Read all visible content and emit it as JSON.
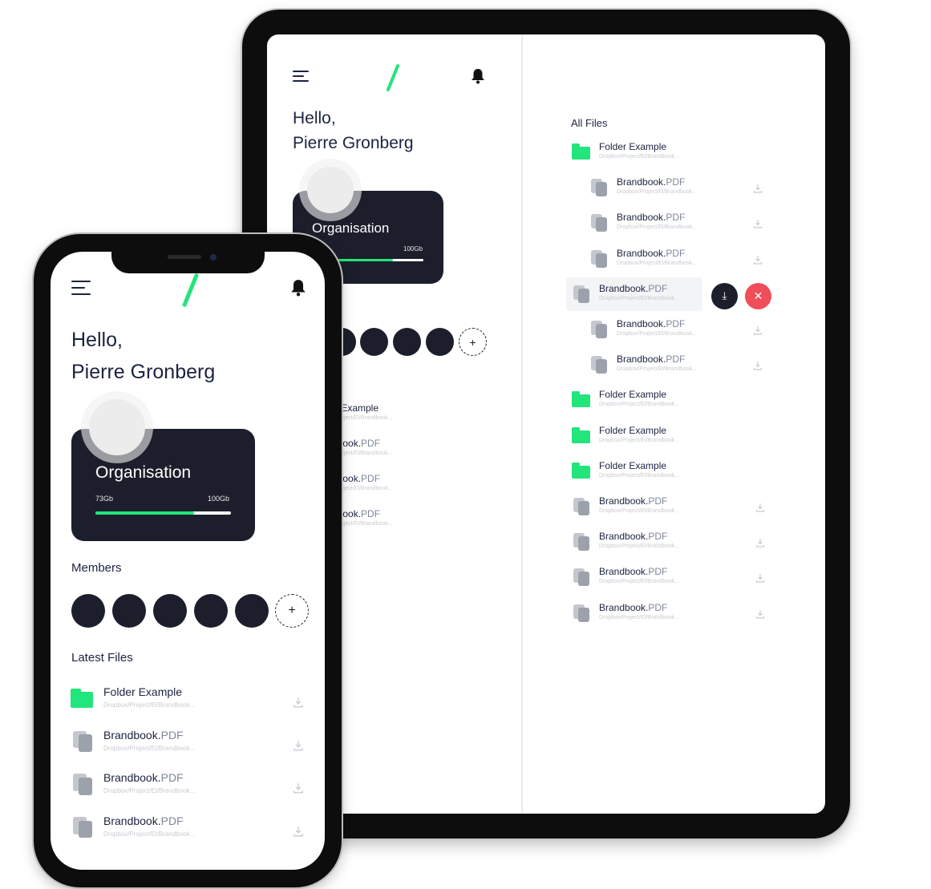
{
  "app": {
    "accent_color": "#22e57c",
    "dark_color": "#1c1f2b",
    "danger_color": "#f04e5a"
  },
  "header": {
    "menu_icon": "hamburger-menu-icon",
    "logo_icon": "green-slash-logo",
    "bell_icon": "bell-icon",
    "bell_glyph": "🔔"
  },
  "greeting": {
    "hello": "Hello,",
    "name": "Pierre Gronberg"
  },
  "organisation": {
    "title": "Organisation",
    "used": "73Gb",
    "total": "100Gb",
    "used_fraction": 0.73
  },
  "members": {
    "title": "Members",
    "count": 5,
    "add_glyph": "+"
  },
  "latest_files": {
    "title": "Latest Files",
    "items": [
      {
        "type": "folder",
        "name": "Folder Example",
        "ext": "",
        "path": "Dropbox/Project/El/Brandbook..."
      },
      {
        "type": "file",
        "name": "Brandbook.",
        "ext": "PDF",
        "path": "Dropbox/Project/El/Brandbook..."
      },
      {
        "type": "file",
        "name": "Brandbook.",
        "ext": "PDF",
        "path": "Dropbox/Project/El/Brandbook..."
      },
      {
        "type": "file",
        "name": "Brandbook.",
        "ext": "PDF",
        "path": "Dropbox/Project/El/Brandbook..."
      }
    ]
  },
  "tablet_partial_list": {
    "items": [
      {
        "name": "r Example",
        "path": "Project/El/Brandbook..."
      },
      {
        "name": "lbook.",
        "ext": "PDF",
        "path": "Project/El/Brandbook..."
      },
      {
        "name": "lbook.",
        "ext": "PDF",
        "path": "Project/El/Brandbook..."
      },
      {
        "name": "lbook.",
        "ext": "PDF",
        "path": "Project/El/Brandbook..."
      }
    ]
  },
  "all_files": {
    "title": "All Files",
    "download_glyph": "⤓",
    "close_glyph": "✕",
    "items": [
      {
        "type": "folder",
        "name": "Folder Example",
        "ext": "",
        "path": "Dropbox/Project/El/Brandbook...",
        "indent": false
      },
      {
        "type": "file",
        "name": "Brandbook.",
        "ext": "PDF",
        "path": "Dropbox/Project/El/Brandbook...",
        "indent": true
      },
      {
        "type": "file",
        "name": "Brandbook.",
        "ext": "PDF",
        "path": "Dropbox/Project/El/Brandbook...",
        "indent": true
      },
      {
        "type": "file",
        "name": "Brandbook.",
        "ext": "PDF",
        "path": "Dropbox/Project/El/Brandbook...",
        "indent": true
      },
      {
        "type": "file",
        "name": "Brandbook.",
        "ext": "PDF",
        "path": "Dropbox/Project/El/Brandbook...",
        "indent": false,
        "selected": true
      },
      {
        "type": "file",
        "name": "Brandbook.",
        "ext": "PDF",
        "path": "Dropbox/Project/El/Brandbook...",
        "indent": true
      },
      {
        "type": "file",
        "name": "Brandbook.",
        "ext": "PDF",
        "path": "Dropbox/Project/El/Brandbook...",
        "indent": true
      },
      {
        "type": "folder",
        "name": "Folder Example",
        "ext": "",
        "path": "Dropbox/Project/El/Brandbook...",
        "indent": false
      },
      {
        "type": "folder",
        "name": "Folder Example",
        "ext": "",
        "path": "Dropbox/Project/El/Brandbook...",
        "indent": false
      },
      {
        "type": "folder",
        "name": "Folder Example",
        "ext": "",
        "path": "Dropbox/Project/El/Brandbook...",
        "indent": false
      },
      {
        "type": "file",
        "name": "Brandbook.",
        "ext": "PDF",
        "path": "Dropbox/Project/El/Brandbook...",
        "indent": false
      },
      {
        "type": "file",
        "name": "Brandbook.",
        "ext": "PDF",
        "path": "Dropbox/Project/El/Brandbook...",
        "indent": false
      },
      {
        "type": "file",
        "name": "Brandbook.",
        "ext": "PDF",
        "path": "Dropbox/Project/El/Brandbook...",
        "indent": false
      },
      {
        "type": "file",
        "name": "Brandbook.",
        "ext": "PDF",
        "path": "Dropbox/Project/El/Brandbook...",
        "indent": false
      }
    ]
  }
}
